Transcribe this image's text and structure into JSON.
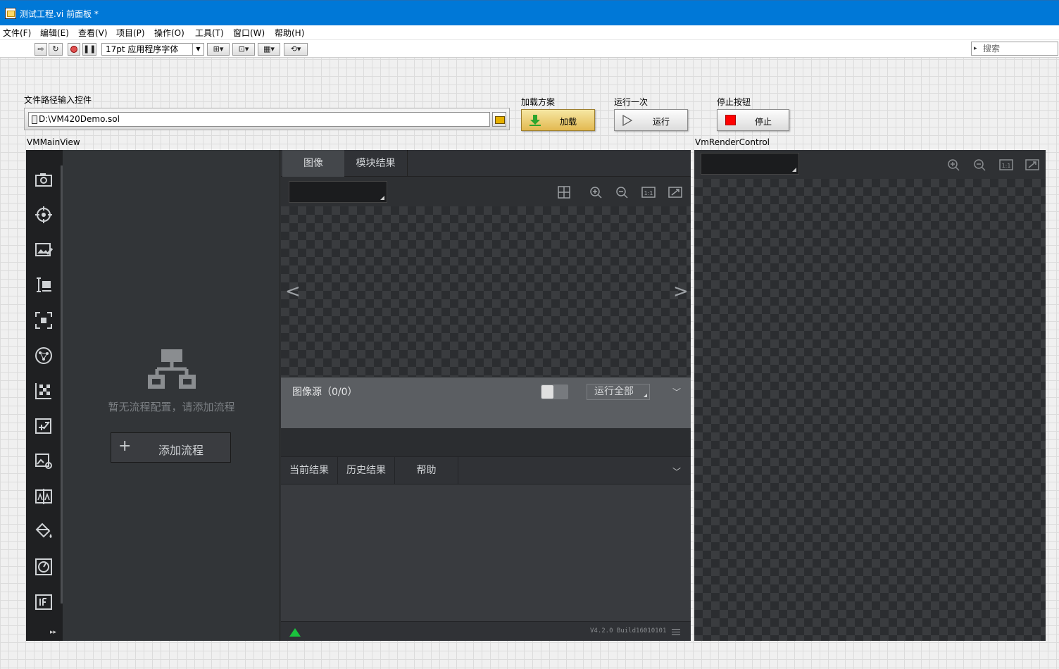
{
  "window": {
    "title": "测试工程.vi 前面板 *"
  },
  "menu": [
    "文件(F)",
    "编辑(E)",
    "查看(V)",
    "项目(P)",
    "操作(O)",
    "工具(T)",
    "窗口(W)",
    "帮助(H)"
  ],
  "toolbar": {
    "font": "17pt 应用程序字体",
    "search_placeholder": "搜索"
  },
  "controls": {
    "path_label": "文件路径输入控件",
    "path_value": "D:\\VM420Demo.sol",
    "load_caption": "加载方案",
    "load_label": "加载",
    "run_caption": "运行一次",
    "run_label": "运行",
    "stop_caption": "停止按钮",
    "stop_label": "停止"
  },
  "vm_main": {
    "caption": "VMMainView",
    "empty_text": "暂无流程配置，请添加流程",
    "add_flow": "添加流程",
    "tabs": [
      "图像",
      "模块结果"
    ],
    "source_title": "图像源（0/0）",
    "run_all": "运行全部",
    "result_tabs": [
      "当前结果",
      "历史结果",
      "帮助"
    ],
    "version": "V4.2.0 Build16010101",
    "tool_icons": [
      "camera-icon",
      "locate-icon",
      "image-edit-icon",
      "measure-icon",
      "focus-icon",
      "network-icon",
      "checker-icon",
      "calc-icon",
      "image-settings-icon",
      "compare-icon",
      "fill-icon",
      "gauge-icon",
      "if-icon"
    ]
  },
  "vm_render": {
    "caption": "VmRenderControl"
  }
}
